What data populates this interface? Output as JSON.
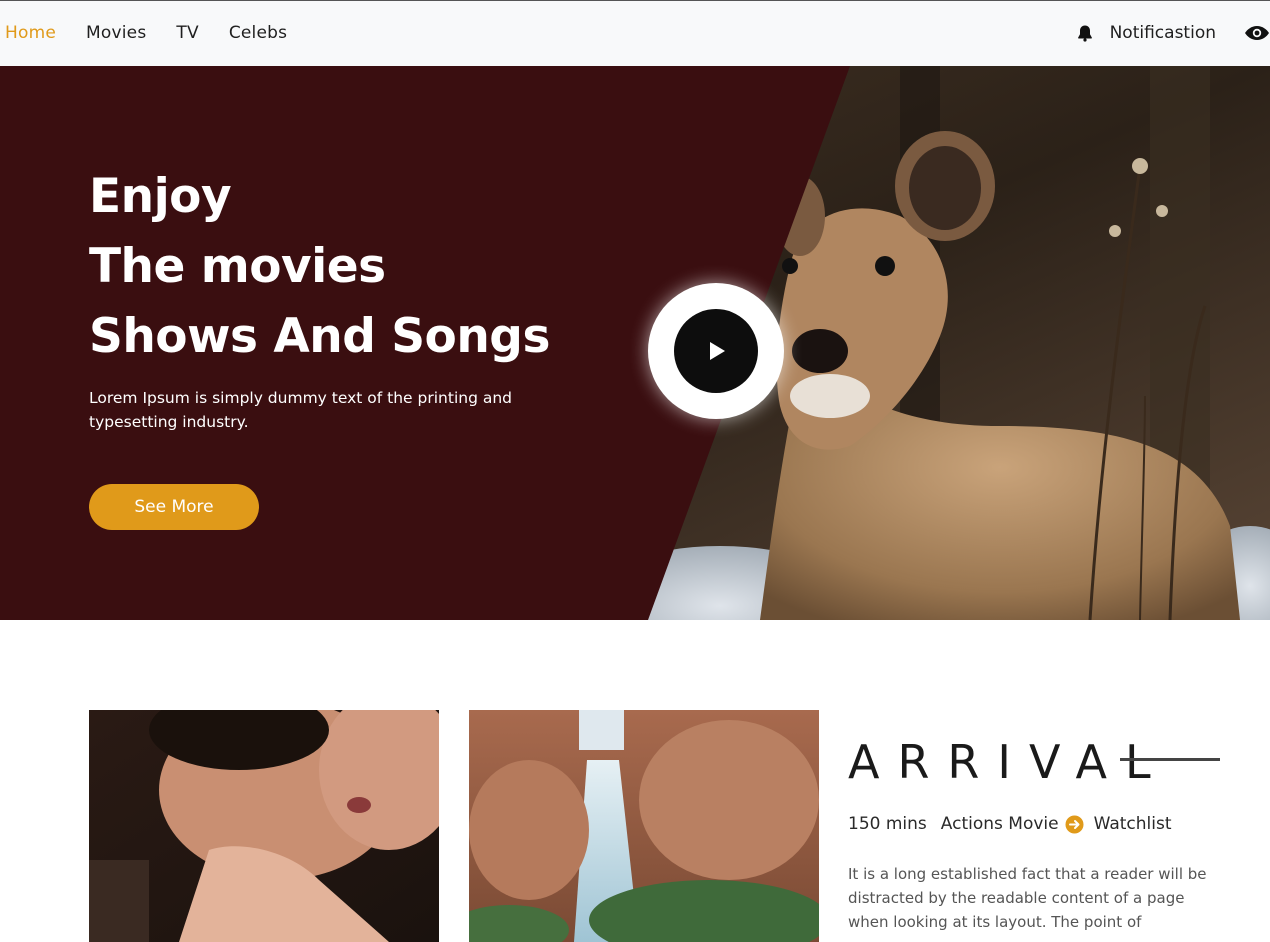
{
  "nav": {
    "links": [
      {
        "label": "Home",
        "active": true
      },
      {
        "label": "Movies"
      },
      {
        "label": "TV"
      },
      {
        "label": "Celebs"
      }
    ],
    "notifications_label": "Notificastion",
    "icons": {
      "bell": "bell-icon",
      "eye": "eye-icon"
    }
  },
  "hero": {
    "title_lines": [
      "Enjoy",
      "The movies",
      "Shows And Songs"
    ],
    "description": "Lorem Ipsum is simply dummy text of the printing and typesetting industry.",
    "button_label": "See More",
    "play_icon": "play-icon"
  },
  "movie": {
    "title": "ARRIVAL",
    "duration": "150 mins",
    "genre": "Actions Movie",
    "watchlist_label": "Watchlist",
    "description": "It is a long established fact that a reader will be distracted by the readable content of a page when looking at its layout. The point of"
  },
  "colors": {
    "accent": "#e09a1a",
    "hero_dark": "#3a0e10",
    "nav_bg": "#f8f9fa",
    "text_dark": "#1f1f1f"
  }
}
